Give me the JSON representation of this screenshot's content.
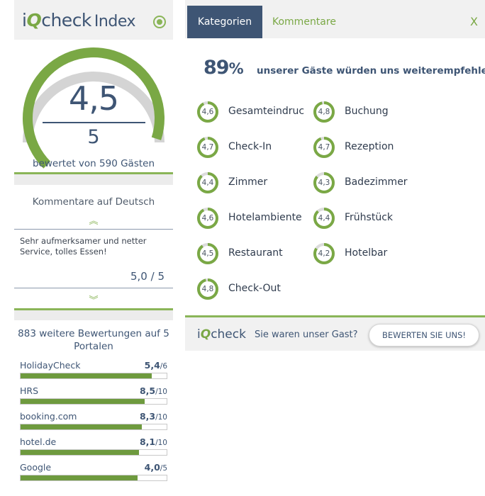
{
  "header": {
    "logo": "iQcheck",
    "logo_i": "i",
    "logo_q": "Q",
    "logo_rest": "check",
    "index": "Index"
  },
  "score": {
    "value": "4,5",
    "max": "5",
    "rated_by": "bewertet von 590 Gästen",
    "fraction": 0.9
  },
  "comments": {
    "title": "Kommentare auf Deutsch",
    "text": "Sehr aufmerksamer und netter Service, tolles Essen!",
    "score": "5,0 / 5"
  },
  "portals": {
    "title": "883 weitere Bewertungen auf 5 Portalen",
    "items": [
      {
        "name": "HolidayCheck",
        "score": "5,4",
        "max": "/6",
        "fraction": 0.9
      },
      {
        "name": "HRS",
        "score": "8,5",
        "max": "/10",
        "fraction": 0.85
      },
      {
        "name": "booking.com",
        "score": "8,3",
        "max": "/10",
        "fraction": 0.83
      },
      {
        "name": "hotel.de",
        "score": "8,1",
        "max": "/10",
        "fraction": 0.81
      },
      {
        "name": "Google",
        "score": "4,0",
        "max": "/5",
        "fraction": 0.8
      }
    ]
  },
  "tabs": {
    "active": "Kategorien",
    "other": "Kommentare",
    "close": "X"
  },
  "recommend": {
    "percent": "89",
    "percent_sign": "%",
    "text": "unserer Gäste würden uns weiterempfehlen."
  },
  "categories": [
    {
      "label": "Gesamteindruc",
      "score": "4,6",
      "value": 4.6
    },
    {
      "label": "Buchung",
      "score": "4,8",
      "value": 4.8
    },
    {
      "label": "Check-In",
      "score": "4,7",
      "value": 4.7
    },
    {
      "label": "Rezeption",
      "score": "4,7",
      "value": 4.7
    },
    {
      "label": "Zimmer",
      "score": "4,4",
      "value": 4.4
    },
    {
      "label": "Badezimmer",
      "score": "4,3",
      "value": 4.3
    },
    {
      "label": "Hotelambiente",
      "score": "4,6",
      "value": 4.6
    },
    {
      "label": "Frühstück",
      "score": "4,4",
      "value": 4.4
    },
    {
      "label": "Restaurant",
      "score": "4,5",
      "value": 4.5
    },
    {
      "label": "Hotelbar",
      "score": "4,2",
      "value": 4.2
    },
    {
      "label": "Check-Out",
      "score": "4,8",
      "value": 4.8
    }
  ],
  "footer": {
    "logo_i": "i",
    "logo_q": "Q",
    "logo_rest": "check",
    "question": "Sie waren unser Gast?",
    "button": "BEWERTEN SIE UNS!"
  },
  "colors": {
    "accent_green": "#8ab558",
    "brand_blue": "#3e5574",
    "gauge_bg": "#d4d4d4"
  },
  "icons": {
    "target": "target-icon",
    "arrow_up": "chevron-double-up-icon",
    "arrow_down": "chevron-double-down-icon"
  }
}
